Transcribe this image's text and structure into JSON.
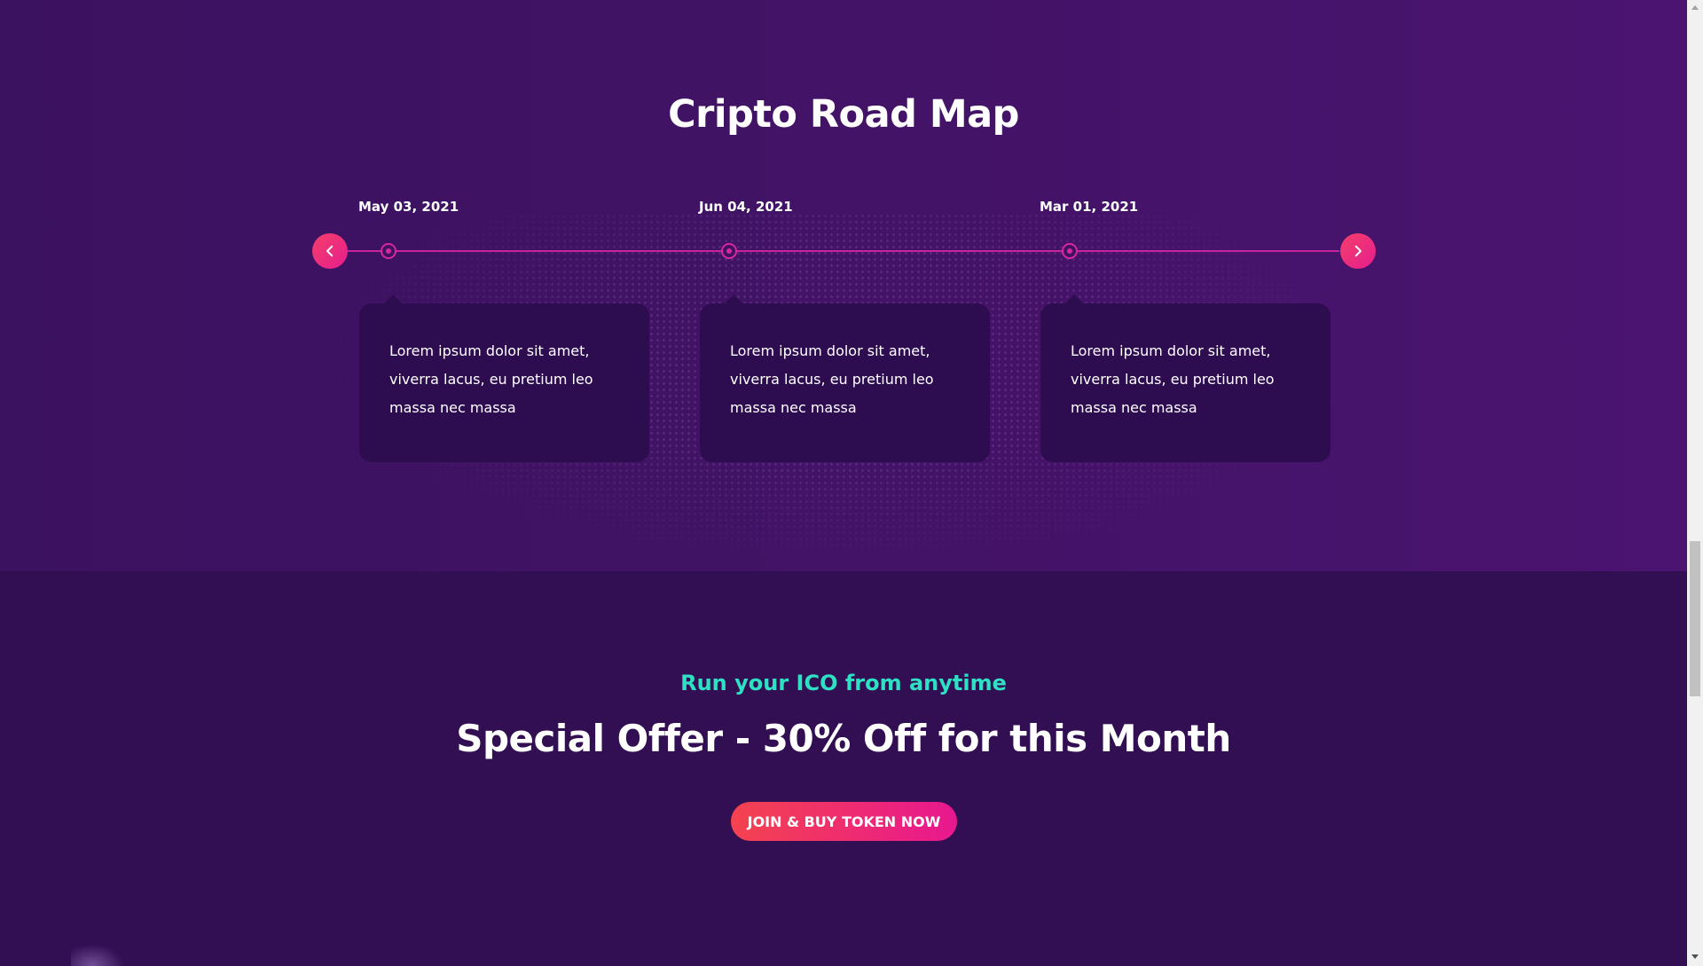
{
  "roadmap": {
    "title": "Cripto Road Map",
    "items": [
      {
        "date": "May 03, 2021",
        "text": "Lorem ipsum dolor sit amet, viverra lacus, eu pretium leo massa nec massa"
      },
      {
        "date": "Jun 04, 2021",
        "text": "Lorem ipsum dolor sit amet, viverra lacus, eu pretium leo massa nec massa"
      },
      {
        "date": "Mar 01, 2021",
        "text": "Lorem ipsum dolor sit amet, viverra lacus, eu pretium leo massa nec massa"
      }
    ],
    "prev_icon": "chevron-left-icon",
    "next_icon": "chevron-right-icon"
  },
  "offer": {
    "subtitle": "Run your ICO from anytime",
    "title": "Special Offer - 30% Off for this Month",
    "cta_label": "JOIN & BUY TOKEN NOW"
  },
  "colors": {
    "accent_pink": "#e61e8e",
    "accent_teal": "#2ee0c4",
    "bg_dark": "#310f52"
  }
}
